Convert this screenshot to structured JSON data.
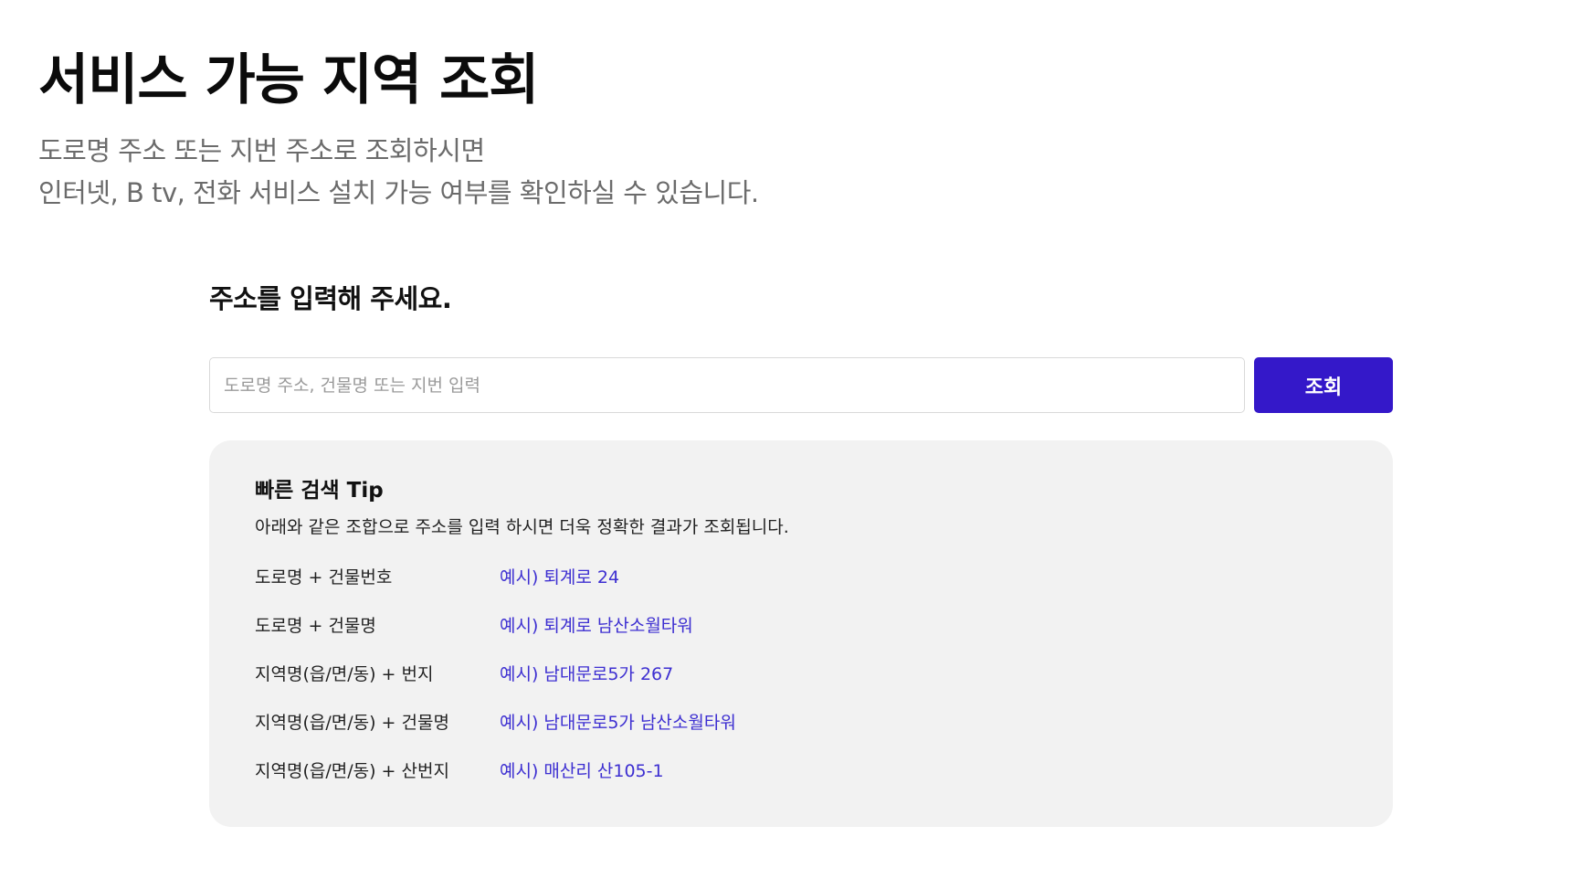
{
  "header": {
    "title": "서비스 가능 지역 조회",
    "description_line1": "도로명 주소 또는 지번 주소로 조회하시면",
    "description_line2": "인터넷, B tv, 전화 서비스 설치 가능 여부를 확인하실 수 있습니다."
  },
  "search": {
    "heading": "주소를 입력해 주세요.",
    "placeholder": "도로명 주소, 건물명 또는 지번 입력",
    "value": "",
    "button_label": "조회"
  },
  "tips": {
    "title": "빠른 검색 Tip",
    "description": "아래와 같은 조합으로 주소를 입력 하시면 더욱 정확한 결과가 조회됩니다.",
    "rows": [
      {
        "label": "도로명 + 건물번호",
        "example": "예시) 퇴계로 24"
      },
      {
        "label": "도로명 + 건물명",
        "example": "예시) 퇴계로 남산소월타워"
      },
      {
        "label": "지역명(읍/면/동) + 번지",
        "example": "예시) 남대문로5가 267"
      },
      {
        "label": "지역명(읍/면/동) + 건물명",
        "example": "예시) 남대문로5가 남산소월타워"
      },
      {
        "label": "지역명(읍/면/동) + 산번지",
        "example": "예시) 매산리 산105-1"
      }
    ]
  },
  "colors": {
    "accent": "#3418c9",
    "example_link": "#3d2fd1",
    "tip_background": "#f2f2f2",
    "description_text": "#6b6b6b"
  }
}
